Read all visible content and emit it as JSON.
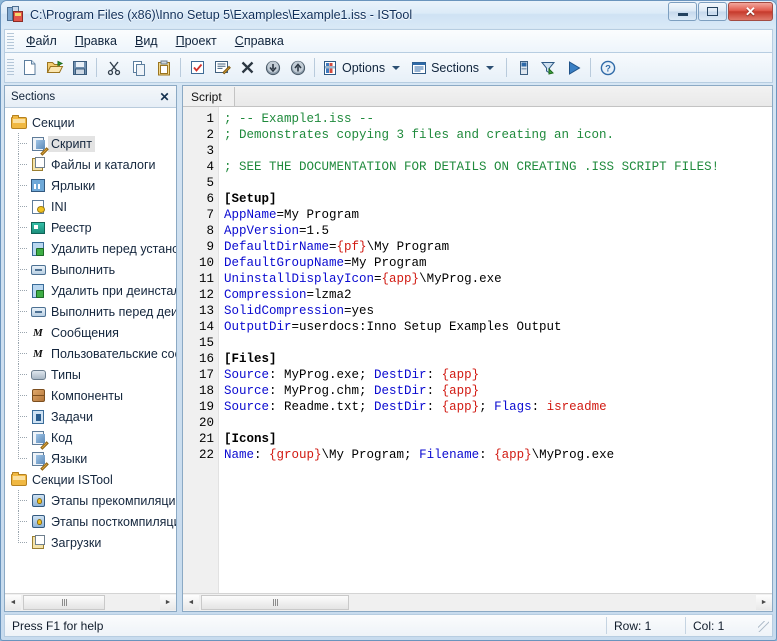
{
  "window": {
    "title": "C:\\Program Files (x86)\\Inno Setup 5\\Examples\\Example1.iss - ISTool",
    "icon": "istool-icon",
    "controls": {
      "minimize": "minimize-button",
      "restore": "restore-button",
      "close": "close-button"
    }
  },
  "menubar": {
    "items": [
      {
        "acc": "Ф",
        "rest": "айл"
      },
      {
        "acc": "П",
        "rest": "равка"
      },
      {
        "acc": "В",
        "rest": "ид"
      },
      {
        "acc": "П",
        "rest": "роект"
      },
      {
        "acc": "С",
        "rest": "правка"
      }
    ]
  },
  "toolbar": {
    "buttons": [
      {
        "name": "new-file-button",
        "icon": "new-document-icon"
      },
      {
        "name": "open-file-button",
        "icon": "open-folder-icon"
      },
      {
        "name": "save-file-button",
        "icon": "floppy-disk-icon"
      },
      {
        "name": "cut-button",
        "icon": "scissors-icon"
      },
      {
        "name": "copy-button",
        "icon": "copy-icon"
      },
      {
        "name": "paste-button",
        "icon": "clipboard-icon"
      },
      {
        "name": "check-button",
        "icon": "checkbox-icon"
      },
      {
        "name": "edit-entry-button",
        "icon": "edit-lines-icon"
      },
      {
        "name": "delete-button",
        "icon": "x-mark-icon"
      },
      {
        "name": "move-down-button",
        "icon": "arrow-down-circle-icon"
      },
      {
        "name": "move-up-button",
        "icon": "arrow-up-circle-icon"
      }
    ],
    "options_label": "Options",
    "options_icon": "options-icon",
    "sections_label": "Sections",
    "sections_icon": "sections-list-icon",
    "tail_buttons": [
      {
        "name": "compile-button",
        "icon": "compile-icon"
      },
      {
        "name": "build-button",
        "icon": "build-filter-icon"
      },
      {
        "name": "run-button",
        "icon": "run-play-icon"
      },
      {
        "name": "help-button",
        "icon": "help-question-icon"
      }
    ]
  },
  "sidebar": {
    "title": "Sections",
    "close_icon": "close-icon",
    "nodes": [
      {
        "label": "Секции",
        "icon": "folder-icon",
        "level": 0,
        "selected": false
      },
      {
        "label": "Скрипт",
        "icon": "script-icon",
        "level": 1,
        "selected": true
      },
      {
        "label": "Файлы и каталоги",
        "icon": "files-icon",
        "level": 1,
        "selected": false
      },
      {
        "label": "Ярлыки",
        "icon": "shortcut-icon",
        "level": 1,
        "selected": false
      },
      {
        "label": "INI",
        "icon": "ini-icon",
        "level": 1,
        "selected": false
      },
      {
        "label": "Реестр",
        "icon": "registry-icon",
        "level": 1,
        "selected": false
      },
      {
        "label": "Удалить перед установкой",
        "icon": "delete-icon",
        "level": 1,
        "selected": false
      },
      {
        "label": "Выполнить",
        "icon": "run-icon",
        "level": 1,
        "selected": false
      },
      {
        "label": "Удалить при деинсталляции",
        "icon": "delete-icon",
        "level": 1,
        "selected": false
      },
      {
        "label": "Выполнить перед деинсталляцией",
        "icon": "run-icon",
        "level": 1,
        "selected": false
      },
      {
        "label": "Сообщения",
        "icon": "messages-icon",
        "level": 1,
        "selected": false
      },
      {
        "label": "Пользовательские сообщения",
        "icon": "messages-icon",
        "level": 1,
        "selected": false
      },
      {
        "label": "Типы",
        "icon": "types-icon",
        "level": 1,
        "selected": false
      },
      {
        "label": "Компоненты",
        "icon": "components-icon",
        "level": 1,
        "selected": false
      },
      {
        "label": "Задачи",
        "icon": "tasks-icon",
        "level": 1,
        "selected": false
      },
      {
        "label": "Код",
        "icon": "script-icon",
        "level": 1,
        "selected": false
      },
      {
        "label": "Языки",
        "icon": "script-icon",
        "level": 1,
        "selected": false
      },
      {
        "label": "Секции ISTool",
        "icon": "folder-icon",
        "level": 0,
        "selected": false
      },
      {
        "label": "Этапы прекомпиляции",
        "icon": "stage-icon",
        "level": 1,
        "selected": false
      },
      {
        "label": "Этапы посткомпиляции",
        "icon": "stage-icon",
        "level": 1,
        "selected": false
      },
      {
        "label": "Загрузки",
        "icon": "downloads-icon",
        "level": 1,
        "selected": false
      }
    ],
    "scrollbar": {
      "left_arrow": "◄",
      "right_arrow": "►"
    }
  },
  "editor": {
    "tab_label": "Script",
    "scrollbar": {
      "left_arrow": "◄",
      "right_arrow": "►"
    },
    "lines": [
      {
        "n": "1",
        "tokens": [
          {
            "t": "; -- Example1.iss --",
            "c": "cm"
          }
        ]
      },
      {
        "n": "2",
        "tokens": [
          {
            "t": "; Demonstrates copying 3 files and creating an icon.",
            "c": "cm"
          }
        ]
      },
      {
        "n": "3",
        "tokens": []
      },
      {
        "n": "4",
        "tokens": [
          {
            "t": "; SEE THE DOCUMENTATION FOR DETAILS ON CREATING .ISS SCRIPT FILES!",
            "c": "cm"
          }
        ]
      },
      {
        "n": "5",
        "tokens": []
      },
      {
        "n": "6",
        "tokens": [
          {
            "t": "[Setup]",
            "c": "sec"
          }
        ]
      },
      {
        "n": "7",
        "tokens": [
          {
            "t": "AppName",
            "c": "kw"
          },
          {
            "t": "=My Program",
            "c": "pl"
          }
        ]
      },
      {
        "n": "8",
        "tokens": [
          {
            "t": "AppVersion",
            "c": "kw"
          },
          {
            "t": "=1.5",
            "c": "pl"
          }
        ]
      },
      {
        "n": "9",
        "tokens": [
          {
            "t": "DefaultDirName",
            "c": "kw"
          },
          {
            "t": "=",
            "c": "pl"
          },
          {
            "t": "{pf}",
            "c": "cst"
          },
          {
            "t": "\\My Program",
            "c": "pl"
          }
        ]
      },
      {
        "n": "10",
        "tokens": [
          {
            "t": "DefaultGroupName",
            "c": "kw"
          },
          {
            "t": "=My Program",
            "c": "pl"
          }
        ]
      },
      {
        "n": "11",
        "tokens": [
          {
            "t": "UninstallDisplayIcon",
            "c": "kw"
          },
          {
            "t": "=",
            "c": "pl"
          },
          {
            "t": "{app}",
            "c": "cst"
          },
          {
            "t": "\\MyProg.exe",
            "c": "pl"
          }
        ]
      },
      {
        "n": "12",
        "tokens": [
          {
            "t": "Compression",
            "c": "kw"
          },
          {
            "t": "=lzma2",
            "c": "pl"
          }
        ]
      },
      {
        "n": "13",
        "tokens": [
          {
            "t": "SolidCompression",
            "c": "kw"
          },
          {
            "t": "=yes",
            "c": "pl"
          }
        ]
      },
      {
        "n": "14",
        "tokens": [
          {
            "t": "OutputDir",
            "c": "kw"
          },
          {
            "t": "=userdocs:Inno Setup Examples Output",
            "c": "pl"
          }
        ]
      },
      {
        "n": "15",
        "tokens": []
      },
      {
        "n": "16",
        "tokens": [
          {
            "t": "[Files]",
            "c": "sec"
          }
        ]
      },
      {
        "n": "17",
        "tokens": [
          {
            "t": "Source",
            "c": "kw"
          },
          {
            "t": ": MyProg.exe; ",
            "c": "pl"
          },
          {
            "t": "DestDir",
            "c": "kw"
          },
          {
            "t": ": ",
            "c": "pl"
          },
          {
            "t": "{app}",
            "c": "cst"
          }
        ]
      },
      {
        "n": "18",
        "tokens": [
          {
            "t": "Source",
            "c": "kw"
          },
          {
            "t": ": MyProg.chm; ",
            "c": "pl"
          },
          {
            "t": "DestDir",
            "c": "kw"
          },
          {
            "t": ": ",
            "c": "pl"
          },
          {
            "t": "{app}",
            "c": "cst"
          }
        ]
      },
      {
        "n": "19",
        "tokens": [
          {
            "t": "Source",
            "c": "kw"
          },
          {
            "t": ": Readme.txt; ",
            "c": "pl"
          },
          {
            "t": "DestDir",
            "c": "kw"
          },
          {
            "t": ": ",
            "c": "pl"
          },
          {
            "t": "{app}",
            "c": "cst"
          },
          {
            "t": "; ",
            "c": "pl"
          },
          {
            "t": "Flags",
            "c": "kw"
          },
          {
            "t": ": ",
            "c": "pl"
          },
          {
            "t": "isreadme",
            "c": "cst"
          }
        ]
      },
      {
        "n": "20",
        "tokens": []
      },
      {
        "n": "21",
        "tokens": [
          {
            "t": "[Icons]",
            "c": "sec"
          }
        ]
      },
      {
        "n": "22",
        "tokens": [
          {
            "t": "Name",
            "c": "kw"
          },
          {
            "t": ": ",
            "c": "pl"
          },
          {
            "t": "{group}",
            "c": "cst"
          },
          {
            "t": "\\My Program; ",
            "c": "pl"
          },
          {
            "t": "Filename",
            "c": "kw"
          },
          {
            "t": ": ",
            "c": "pl"
          },
          {
            "t": "{app}",
            "c": "cst"
          },
          {
            "t": "\\MyProg.exe",
            "c": "pl"
          }
        ]
      }
    ]
  },
  "statusbar": {
    "hint": "Press F1 for help",
    "row": "Row: 1",
    "col": "Col: 1"
  },
  "colors": {
    "comment": "#1f8a3c",
    "keyword": "#0a0ad0",
    "constant": "#d11a12",
    "section": "#000000",
    "accent": "#2c4f73"
  }
}
